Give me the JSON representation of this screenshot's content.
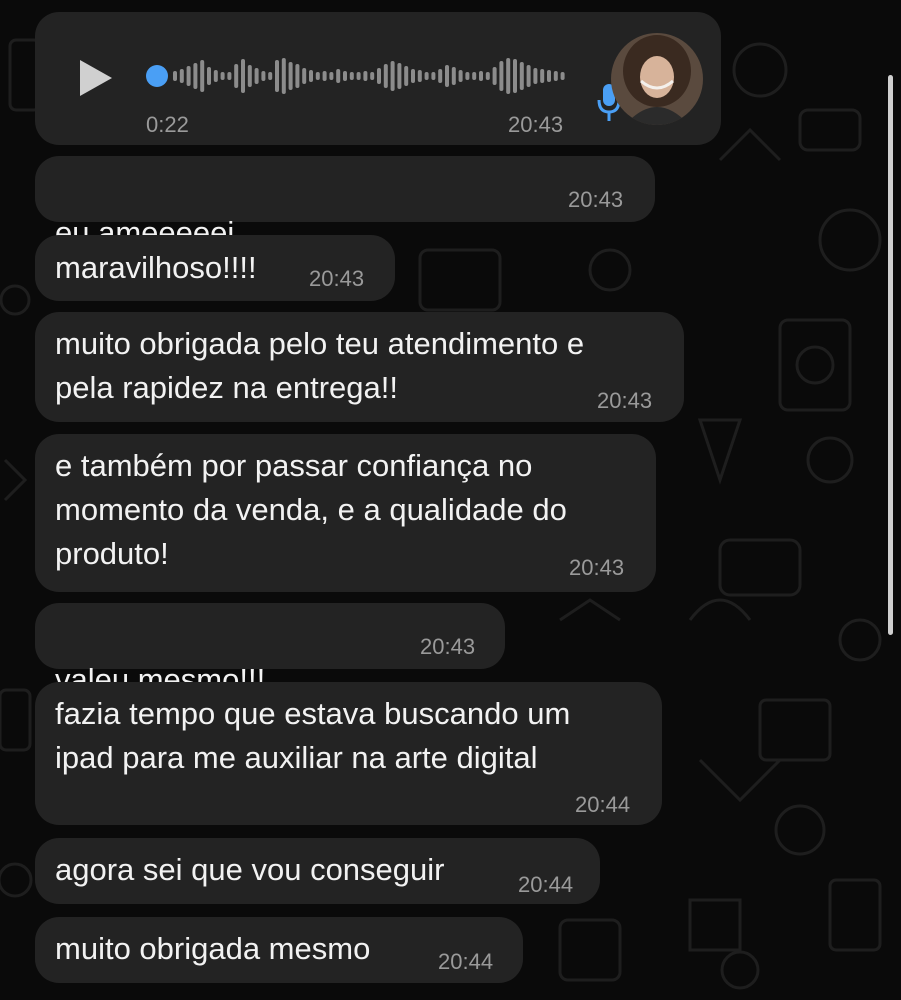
{
  "voice_message": {
    "duration": "0:22",
    "time": "20:43",
    "icons": [
      "play-icon",
      "microphone-icon",
      "contact-avatar"
    ],
    "accent": "#4a9ff5"
  },
  "messages": [
    {
      "text": "eu ameeeeei",
      "emojis": "🥺💖💖💖💖💖",
      "time": "20:43"
    },
    {
      "text": "maravilhoso!!!!",
      "time": "20:43"
    },
    {
      "text": "muito obrigada pelo teu atendimento e\npela rapidez na entrega!!",
      "time": "20:43"
    },
    {
      "text": "e também por passar confiança no\nmomento da venda, e a qualidade do\nproduto!",
      "time": "20:43"
    },
    {
      "text": "valeu mesmo!!!",
      "emojis": "🙏🙌",
      "time": "20:43"
    },
    {
      "text": "fazia tempo que estava buscando um\nipad para me auxiliar na arte digital",
      "time": "20:44"
    },
    {
      "text": "agora sei que vou conseguir",
      "time": "20:44"
    },
    {
      "text": "muito obrigada mesmo",
      "time": "20:44"
    }
  ],
  "colors": {
    "background": "#0a0a0a",
    "bubble": "#232323",
    "text": "#f2f2f2",
    "timestamp": "#9a9a9a"
  }
}
